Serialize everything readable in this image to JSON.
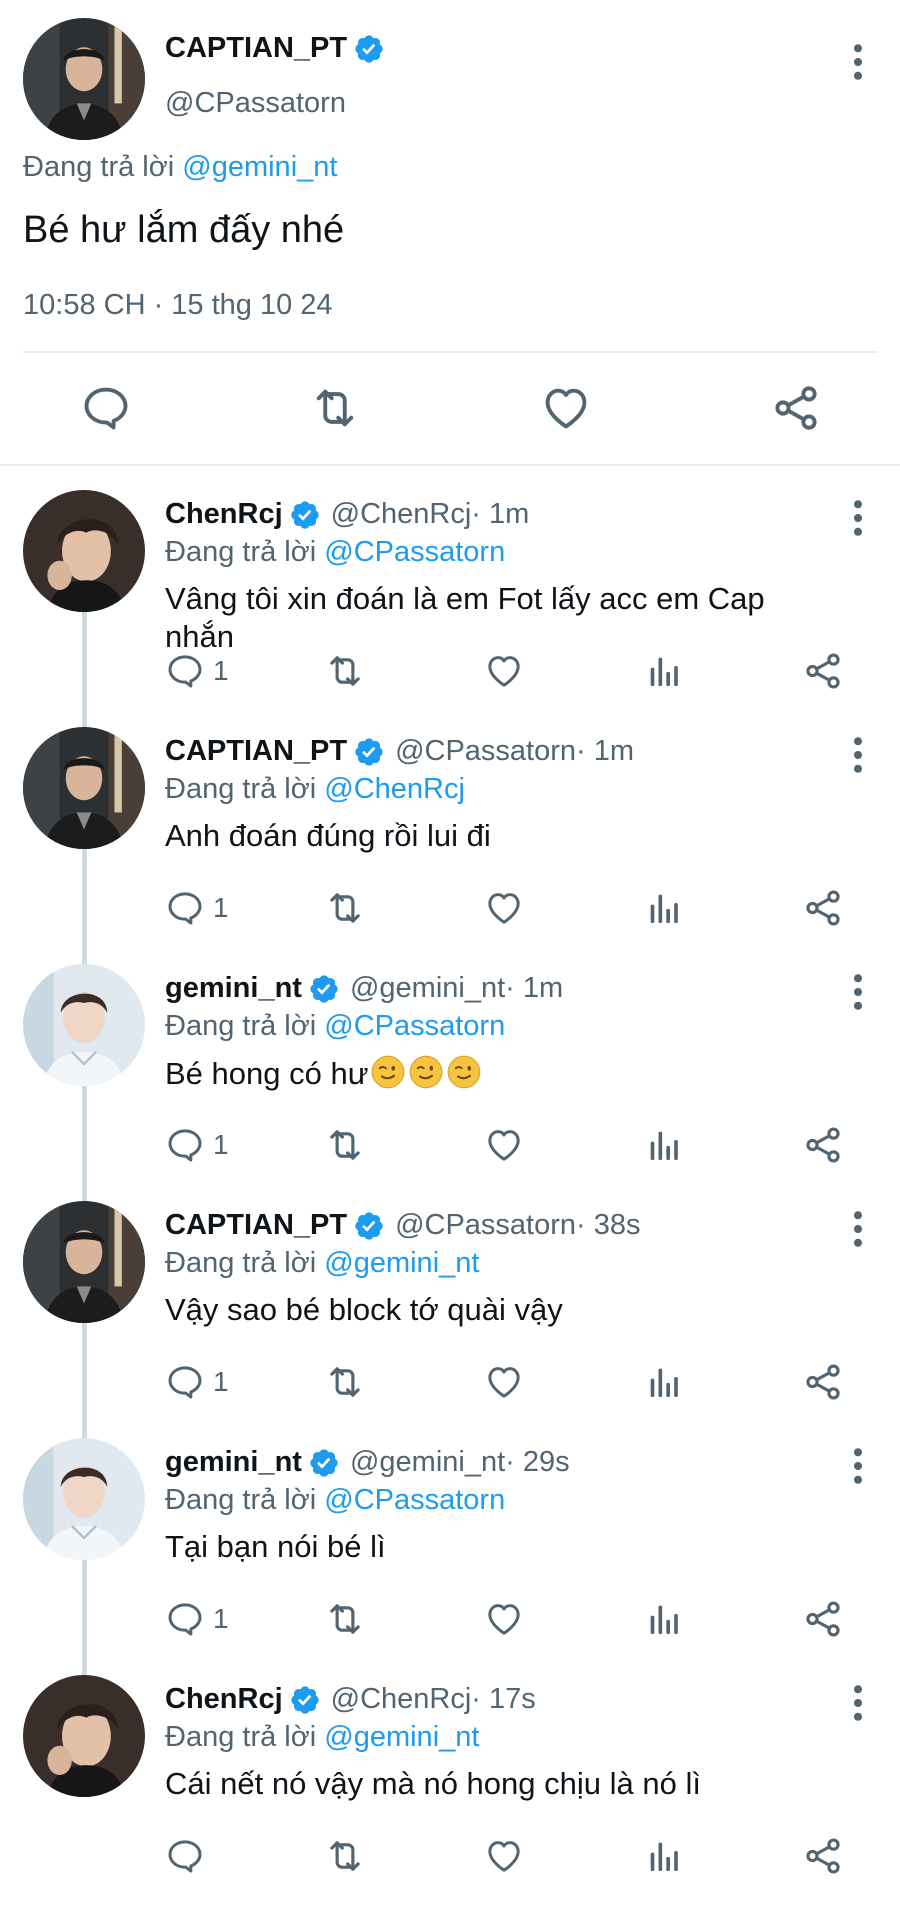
{
  "main_tweet": {
    "name": "CAPTIAN_PT",
    "handle": "@CPassatorn",
    "replying_prefix": "Đang trả lời",
    "replying_to": "@gemini_nt",
    "text": "Bé hư lắm đấy nhé",
    "timestamp": "10:58 CH · 15 thg 10 24",
    "action_icons": [
      "reply-icon",
      "retweet-icon",
      "like-icon",
      "share-icon"
    ]
  },
  "replies": [
    {
      "name": "ChenRcj",
      "handle": "@ChenRcj",
      "time": " · 1m",
      "replying_prefix": "Đang trả lời",
      "replying_to": "@CPassatorn",
      "text": "Vâng tôi xin đoán là em Fot lấy acc em Cap nhắn",
      "reply_count": "1",
      "avatar": "chen"
    },
    {
      "name": "CAPTIAN_PT",
      "handle": "@CPassatorn",
      "time": " · 1m",
      "replying_prefix": "Đang trả lời",
      "replying_to": "@ChenRcj",
      "text": "Anh đoán đúng rồi lui đi",
      "reply_count": "1",
      "avatar": "captian"
    },
    {
      "name": "gemini_nt",
      "handle": "@gemini_nt",
      "time": " · 1m",
      "replying_prefix": "Đang trả lời",
      "replying_to": "@CPassatorn",
      "text": "Bé hong có hư",
      "emoji": "winking-face-emoji",
      "reply_count": "1",
      "avatar": "gemini"
    },
    {
      "name": "CAPTIAN_PT",
      "handle": "@CPassatorn",
      "time": " · 38s",
      "replying_prefix": "Đang trả lời",
      "replying_to": "@gemini_nt",
      "text": "Vậy sao bé block tớ quài vậy",
      "reply_count": "1",
      "avatar": "captian"
    },
    {
      "name": "gemini_nt",
      "handle": "@gemini_nt",
      "time": " · 29s",
      "replying_prefix": "Đang trả lời",
      "replying_to": "@CPassatorn",
      "text": "Tại bạn nói bé lì",
      "reply_count": "1",
      "avatar": "gemini"
    },
    {
      "name": "ChenRcj",
      "handle": "@ChenRcj",
      "time": " · 17s",
      "replying_prefix": "Đang trả lời",
      "replying_to": "@gemini_nt",
      "text": "Cái nết nó vậy mà nó hong chịu là nó lì",
      "reply_count": "",
      "avatar": "chen"
    }
  ],
  "colors": {
    "accent": "#1d9bf0",
    "secondary_text": "#536471",
    "primary_text": "#0f1419",
    "divider": "#e6ecf0",
    "thread_line": "#cfd9de"
  }
}
